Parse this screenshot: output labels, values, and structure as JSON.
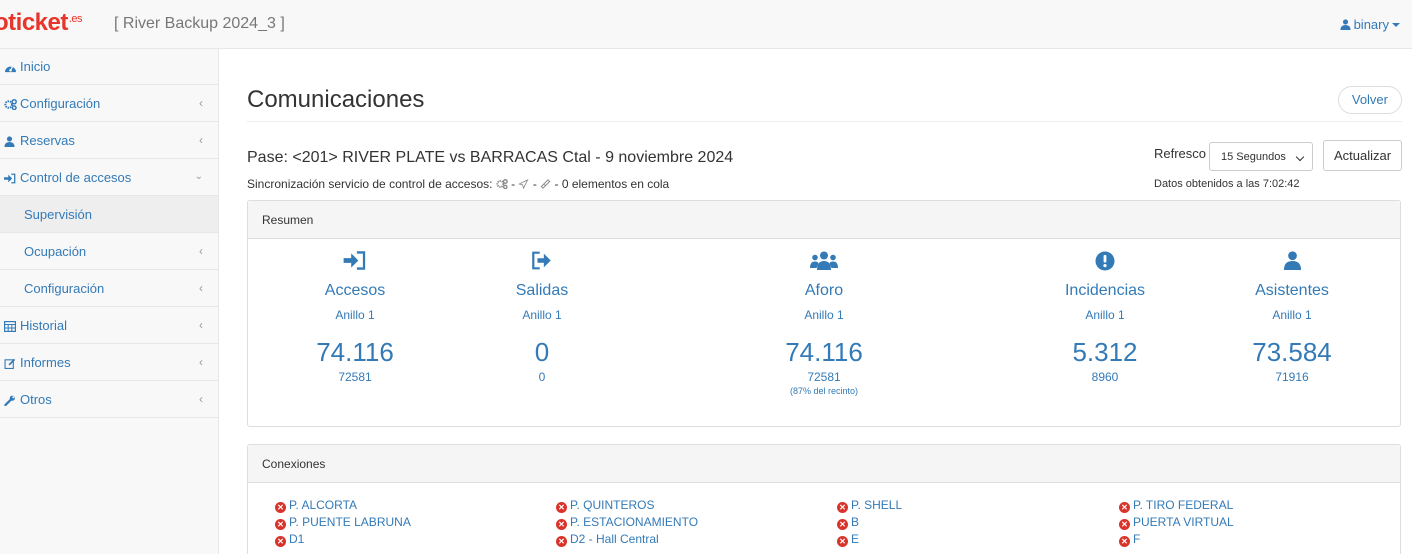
{
  "topbar": {
    "logo_text": "oticket",
    "logo_suffix": ".es",
    "event_title": "[ River Backup 2024_3 ]",
    "user": "binary"
  },
  "sidebar": {
    "items": [
      {
        "label": "Inicio",
        "icon": "dashboard-icon"
      },
      {
        "label": "Configuración",
        "icon": "cogs-icon"
      },
      {
        "label": "Reservas",
        "icon": "user-icon"
      },
      {
        "label": "Control de accesos",
        "icon": "sign-in-icon"
      },
      {
        "label": "Supervisión"
      },
      {
        "label": "Ocupación"
      },
      {
        "label": "Configuración"
      },
      {
        "label": "Historial",
        "icon": "table-icon"
      },
      {
        "label": "Informes",
        "icon": "edit-icon"
      },
      {
        "label": "Otros",
        "icon": "wrench-icon"
      }
    ]
  },
  "main": {
    "title": "Comunicaciones",
    "volver_label": "Volver",
    "pase": "Pase: <201> RIVER PLATE vs BARRACAS Ctal - 9 noviembre 2024",
    "sync_text": "Sincronización servicio de control de accesos:",
    "sync_count_text": "0 elementos en cola",
    "refresh_label": "Refresco",
    "refresh_value": "15 Segundos",
    "actualizar_label": "Actualizar",
    "datos_text": "Datos obtenidos a las 7:02:42"
  },
  "resumen": {
    "heading": "Resumen",
    "stats": [
      {
        "name": "Accesos",
        "ring": "Anillo 1",
        "value": "74.116",
        "sub": "72581",
        "icon": "sign-in-icon"
      },
      {
        "name": "Salidas",
        "ring": "Anillo 1",
        "value": "0",
        "sub": "0",
        "icon": "sign-out-icon"
      },
      {
        "name": "Aforo",
        "ring": "Anillo 1",
        "value": "74.116",
        "sub": "72581",
        "note": "(87% del recinto)",
        "icon": "users-icon"
      },
      {
        "name": "Incidencias",
        "ring": "Anillo 1",
        "value": "5.312",
        "sub": "8960",
        "icon": "exclamation-circle-icon"
      },
      {
        "name": "Asistentes",
        "ring": "Anillo 1",
        "value": "73.584",
        "sub": "71916",
        "icon": "user-icon"
      }
    ]
  },
  "conexiones": {
    "heading": "Conexiones",
    "items": [
      "P. ALCORTA",
      "P. QUINTEROS",
      "P. SHELL",
      "P. TIRO FEDERAL",
      "P. PUENTE LABRUNA",
      "P. ESTACIONAMIENTO",
      "B",
      "PUERTA VIRTUAL",
      "D1",
      "D2 - Hall Central",
      "E",
      "F"
    ],
    "status_color": "#d9342b"
  }
}
